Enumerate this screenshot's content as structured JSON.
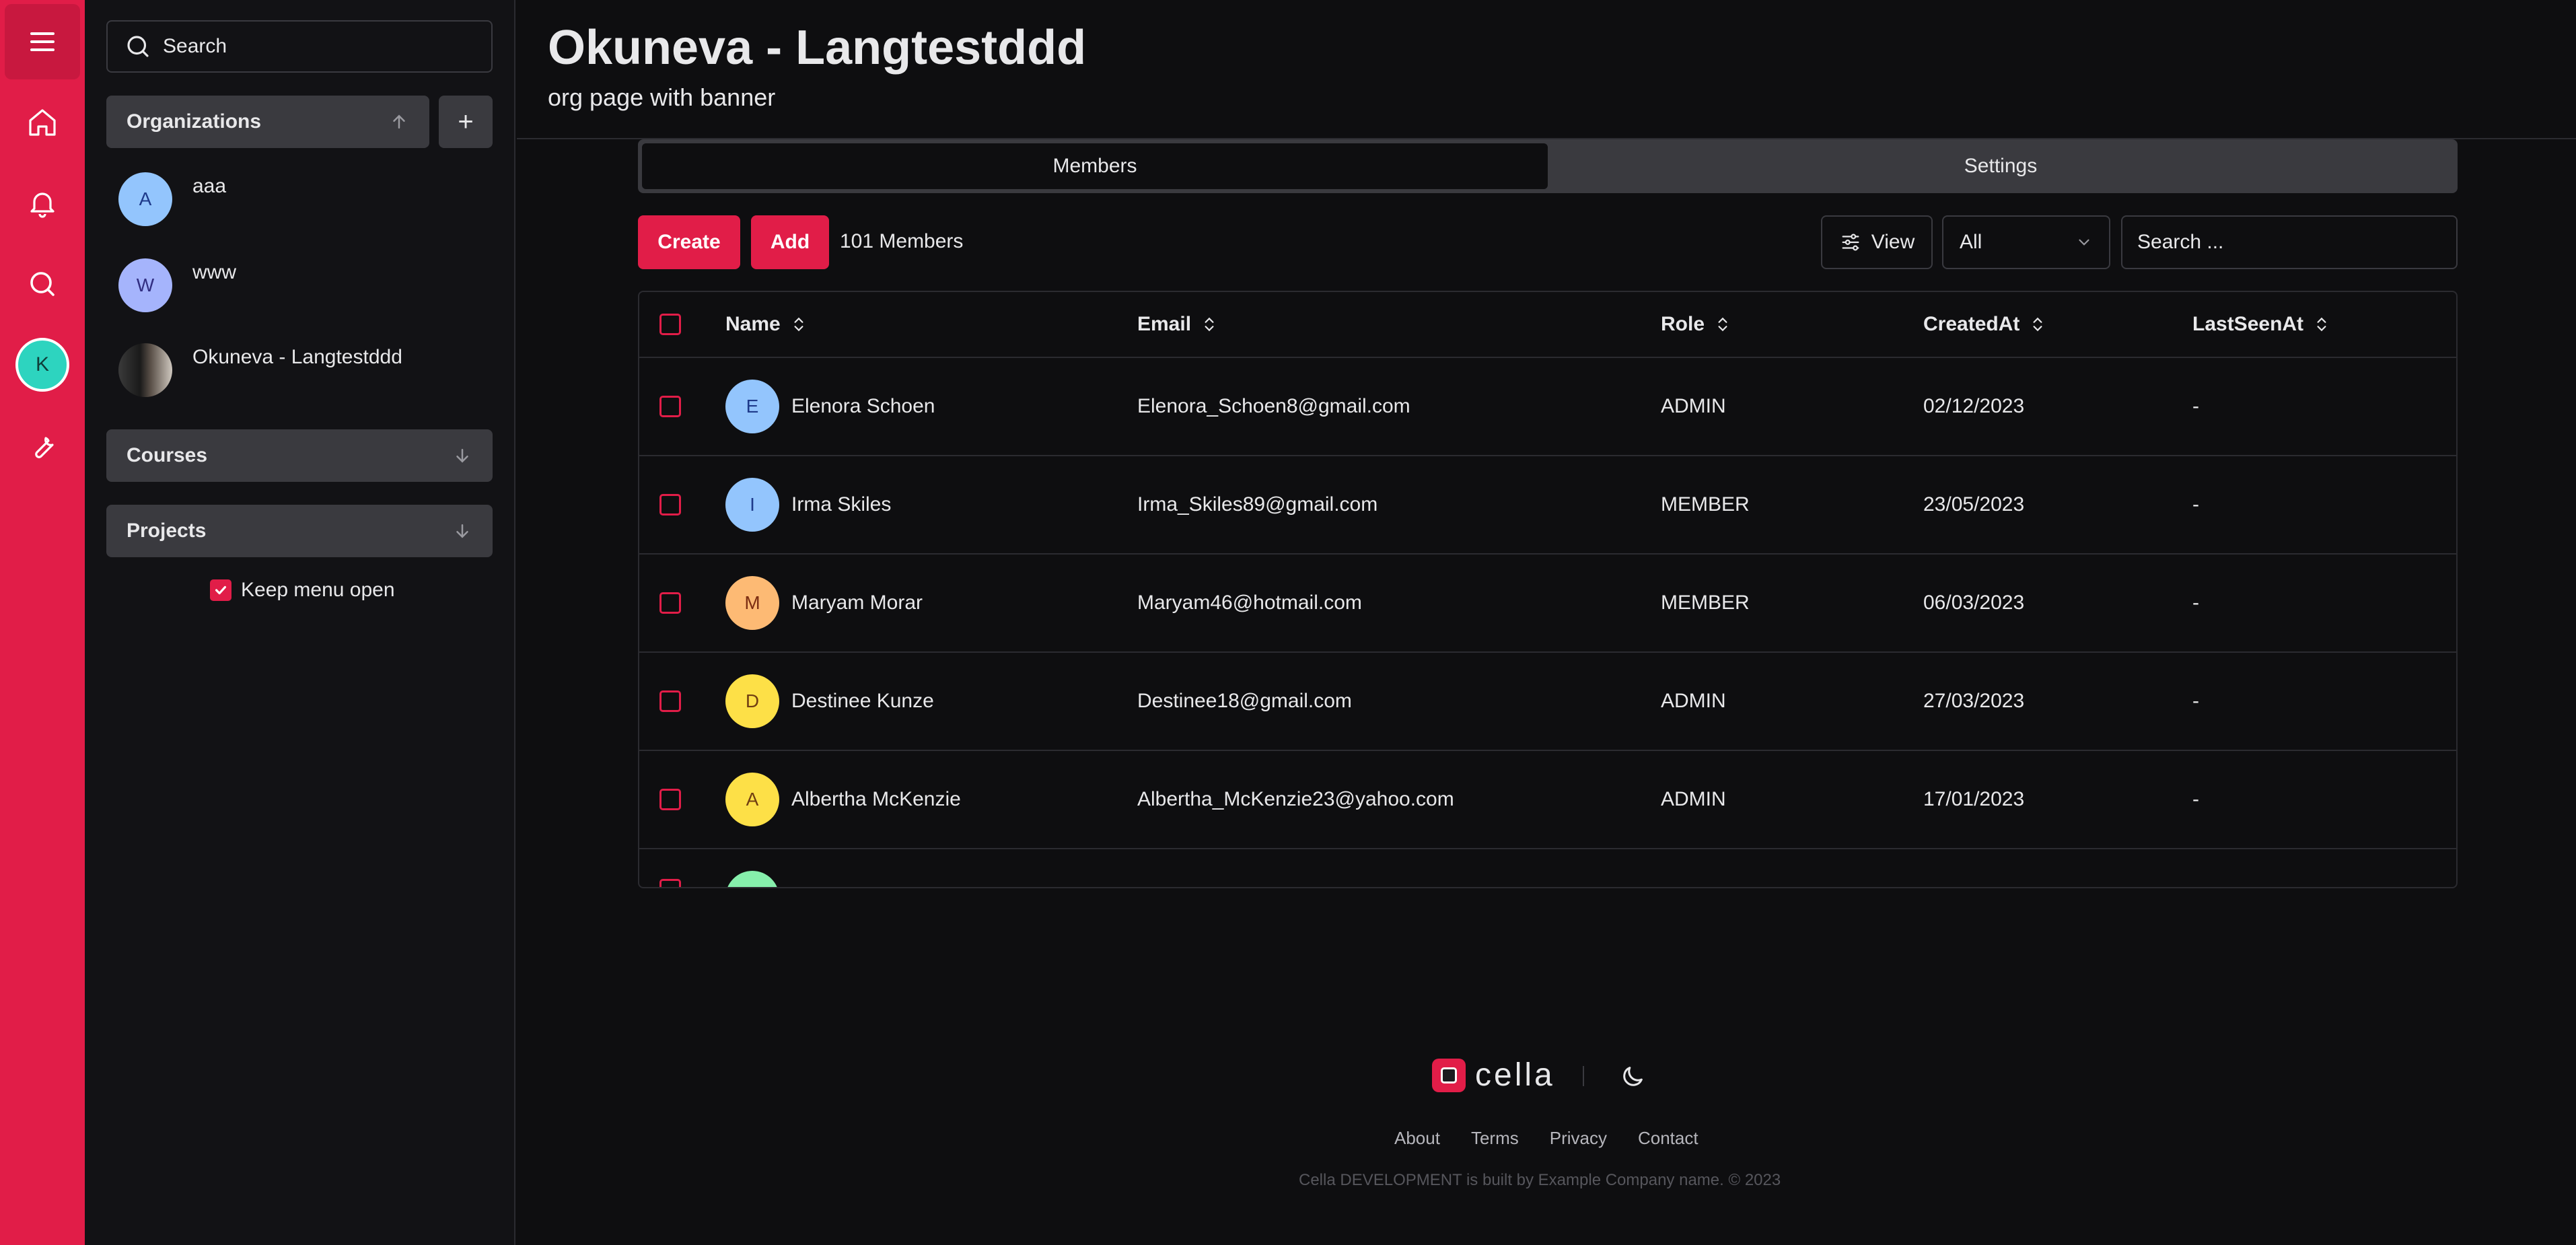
{
  "app": {
    "accent": "#e11d48"
  },
  "rail": {
    "items": [
      {
        "icon": "menu-icon"
      },
      {
        "icon": "home-icon"
      },
      {
        "icon": "bell-icon"
      },
      {
        "icon": "search-icon"
      },
      {
        "icon": "user-avatar",
        "initial": "K"
      },
      {
        "icon": "wrench-icon"
      }
    ]
  },
  "sidebar": {
    "search_label": "Search",
    "organizations_label": "Organizations",
    "add_symbol": "+",
    "orgs": [
      {
        "initial": "A",
        "name": "aaa",
        "color": "#93c5fd"
      },
      {
        "initial": "W",
        "name": "www",
        "color": "#a5b4fc"
      },
      {
        "initial": "",
        "name": "Okuneva - Langtestddd",
        "color": "#444"
      }
    ],
    "courses_label": "Courses",
    "projects_label": "Projects",
    "keep_open_label": "Keep menu open",
    "keep_open_checked": true
  },
  "page": {
    "title": "Okuneva - Langtestddd",
    "subtitle": "org page with banner"
  },
  "tabs": [
    {
      "label": "Members",
      "active": true
    },
    {
      "label": "Settings",
      "active": false
    }
  ],
  "toolbar": {
    "create_label": "Create",
    "add_label": "Add",
    "member_count": "101 Members",
    "view_label": "View",
    "filter_value": "All",
    "search_placeholder": "Search ..."
  },
  "table": {
    "columns": [
      "Name",
      "Email",
      "Role",
      "CreatedAt",
      "LastSeenAt"
    ],
    "rows": [
      {
        "initial": "E",
        "color": "#93c5fd",
        "name": "Elenora Schoen",
        "email": "Elenora_Schoen8@gmail.com",
        "role": "ADMIN",
        "created": "02/12/2023",
        "last_seen": "-"
      },
      {
        "initial": "I",
        "color": "#93c5fd",
        "name": "Irma Skiles",
        "email": "Irma_Skiles89@gmail.com",
        "role": "MEMBER",
        "created": "23/05/2023",
        "last_seen": "-"
      },
      {
        "initial": "M",
        "color": "#fdba74",
        "name": "Maryam Morar",
        "email": "Maryam46@hotmail.com",
        "role": "MEMBER",
        "created": "06/03/2023",
        "last_seen": "-"
      },
      {
        "initial": "D",
        "color": "#fde047",
        "name": "Destinee Kunze",
        "email": "Destinee18@gmail.com",
        "role": "ADMIN",
        "created": "27/03/2023",
        "last_seen": "-"
      },
      {
        "initial": "A",
        "color": "#fde047",
        "name": "Albertha McKenzie",
        "email": "Albertha_McKenzie23@yahoo.com",
        "role": "ADMIN",
        "created": "17/01/2023",
        "last_seen": "-"
      }
    ]
  },
  "footer": {
    "logo_text": "cella",
    "links": [
      "About",
      "Terms",
      "Privacy",
      "Contact"
    ],
    "copyright": "Cella DEVELOPMENT is built by Example Company name. © 2023"
  }
}
